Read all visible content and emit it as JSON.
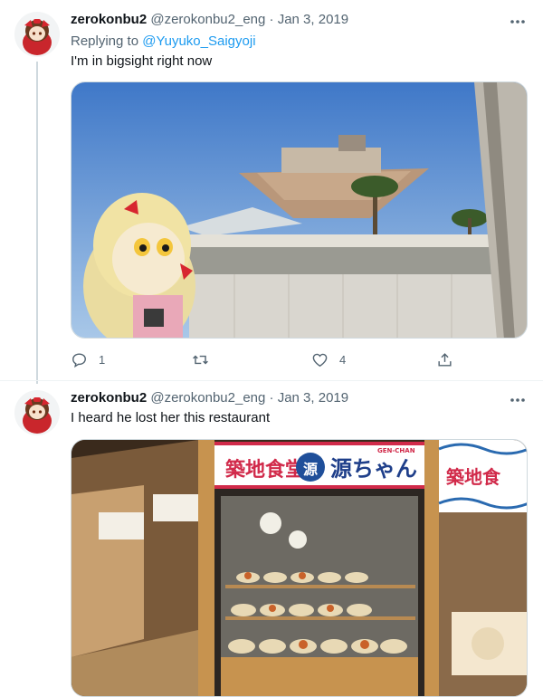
{
  "tweets": [
    {
      "name": "zerokonbu2",
      "handle": "@zerokonbu2_eng",
      "sep": "·",
      "date": "Jan 3, 2019",
      "replying_prefix": "Replying to",
      "replying_to": "@Yuyuko_Saigyoji",
      "text": "I'm in bigsight right now",
      "actions": {
        "reply_count": "1",
        "retweet_count": "",
        "like_count": "4"
      }
    },
    {
      "name": "zerokonbu2",
      "handle": "@zerokonbu2_eng",
      "sep": "·",
      "date": "Jan 3, 2019",
      "text": "I heard he lost her this restaurant",
      "sign": {
        "brand_left": "築地食堂",
        "brand_logo": "源",
        "brand_right": "源ちゃん",
        "brand_tag": "GEN-CHAN",
        "side_sign": "築地食"
      }
    }
  ],
  "colors": {
    "text": "#0f1419",
    "secondary": "#536471",
    "link": "#1d9bf0",
    "border": "#cfd9de"
  },
  "icons": [
    "more-icon",
    "reply-icon",
    "retweet-icon",
    "like-icon",
    "share-icon"
  ]
}
